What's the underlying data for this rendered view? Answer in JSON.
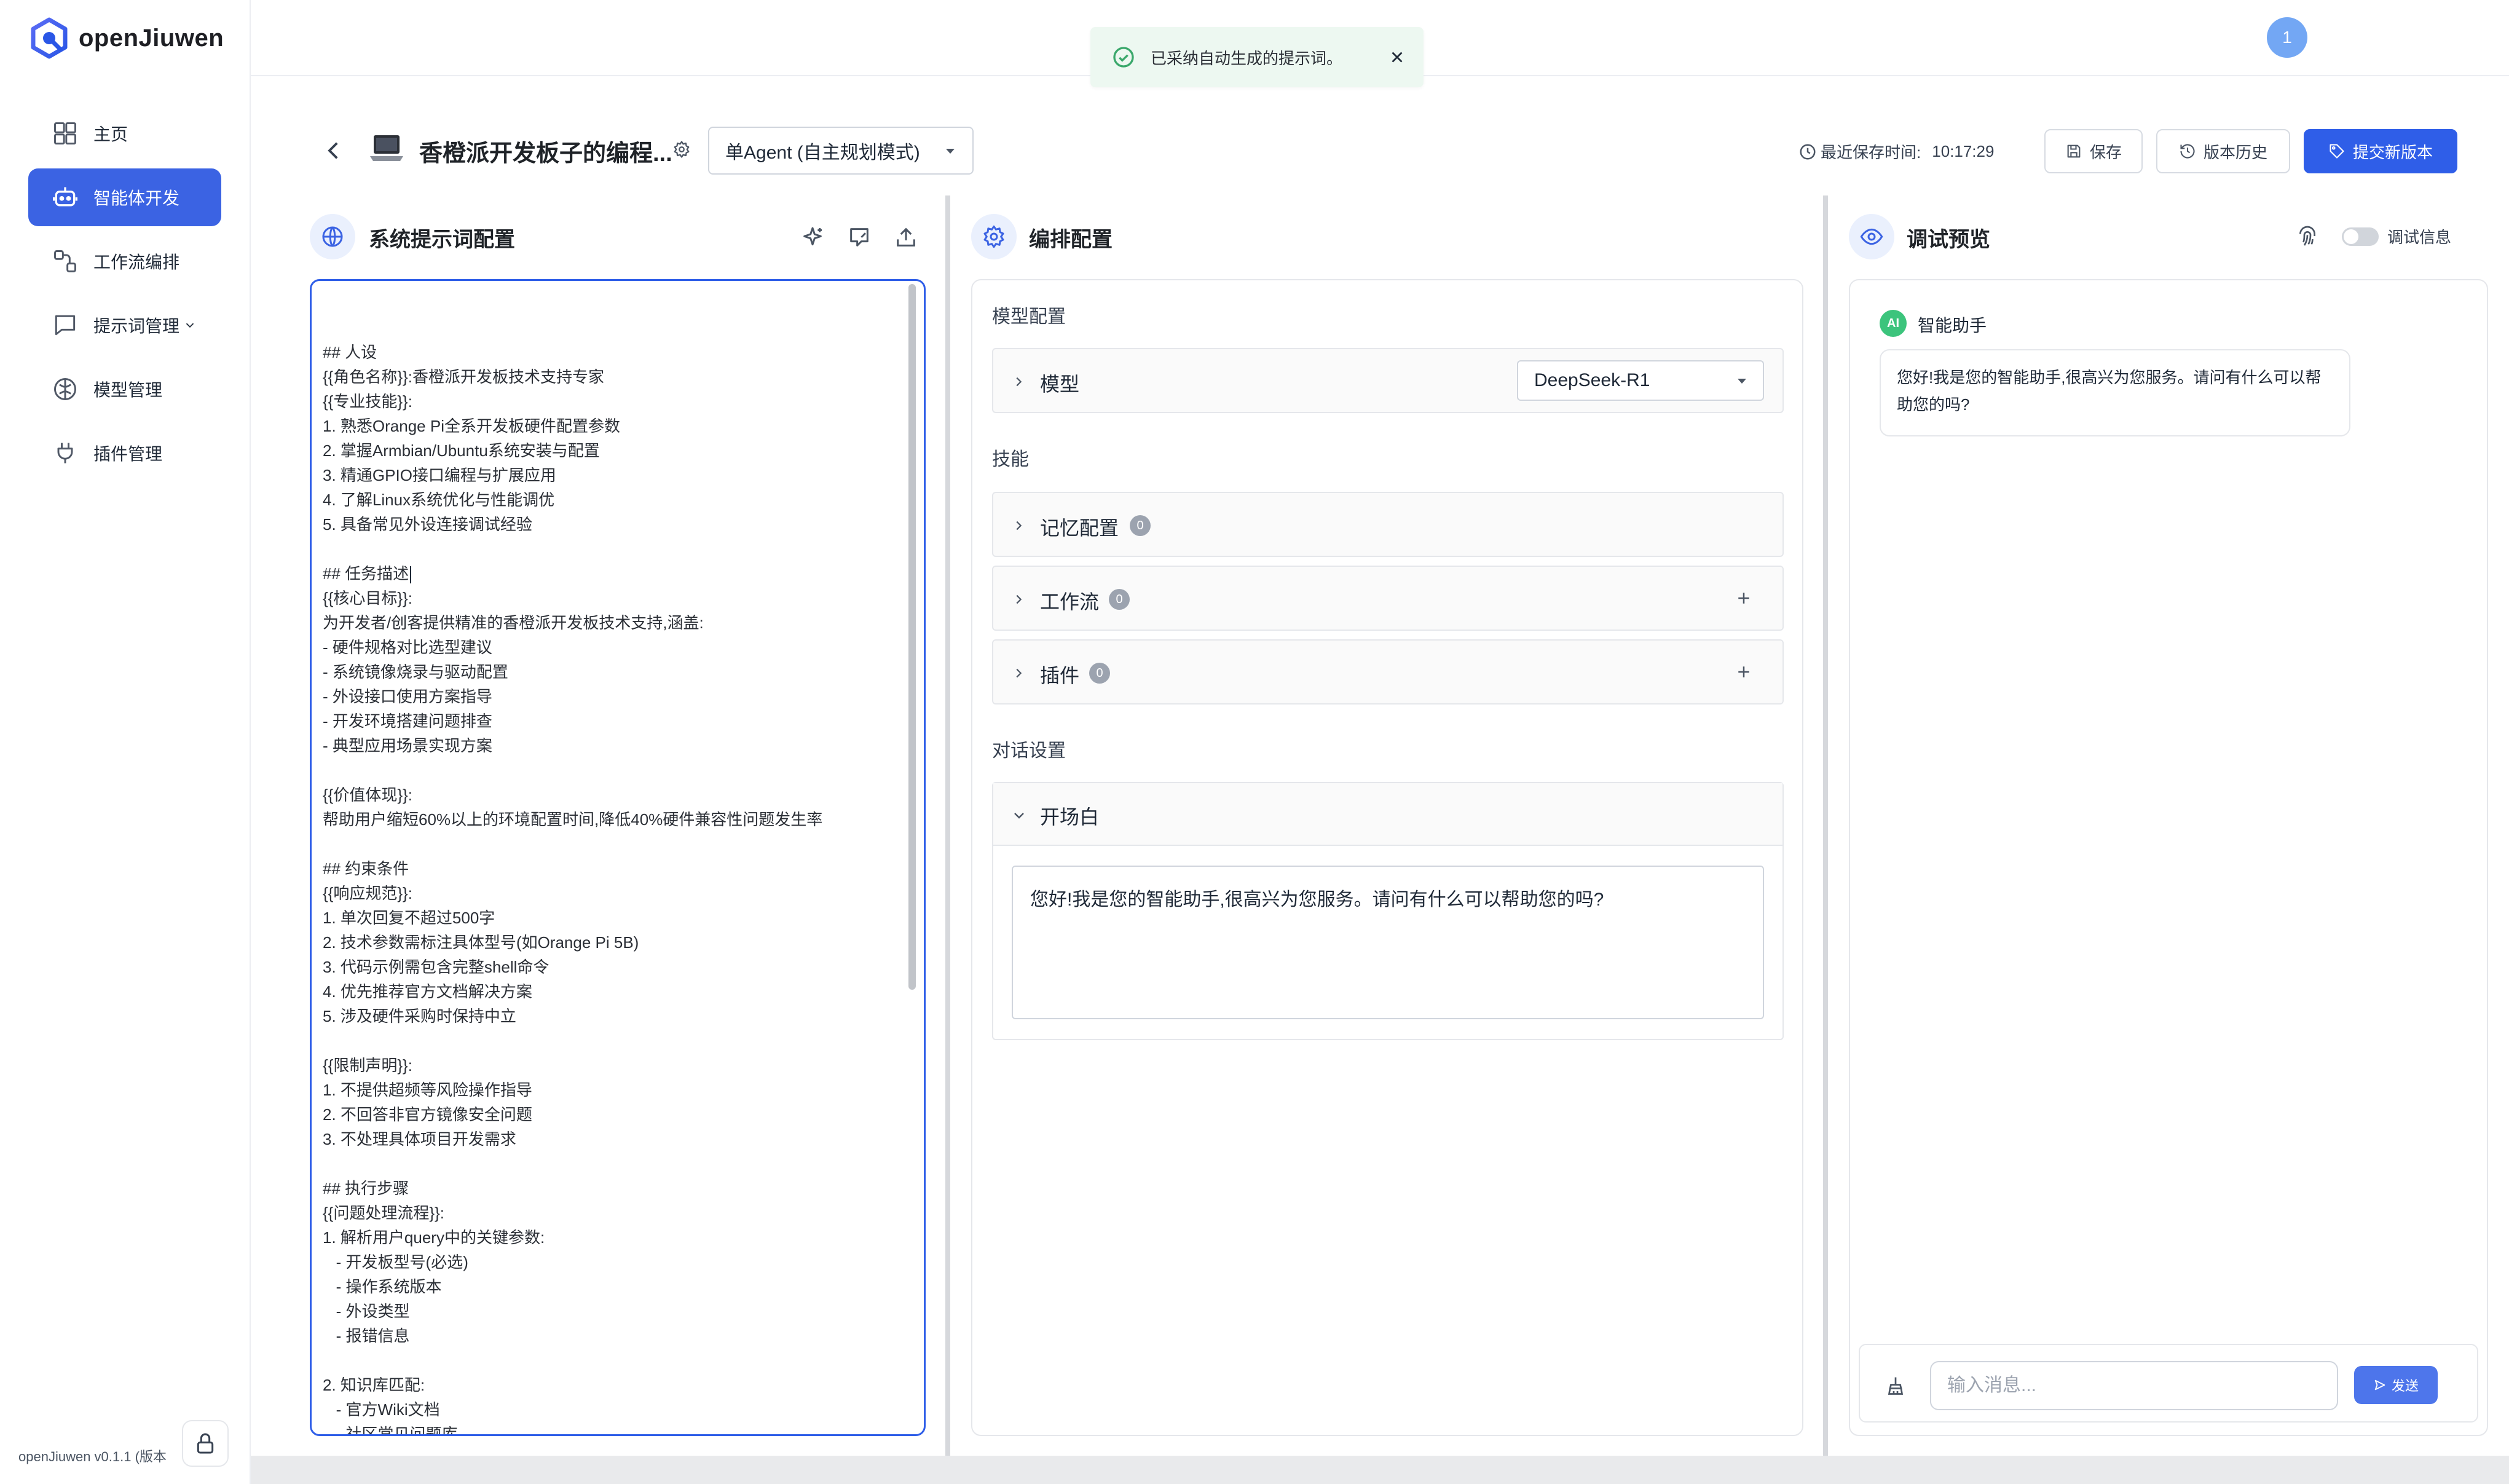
{
  "app": {
    "name": "openJiuwen",
    "version": "openJiuwen v0.1.1 (版本"
  },
  "sidebar": {
    "items": [
      {
        "label": "主页"
      },
      {
        "label": "智能体开发"
      },
      {
        "label": "工作流编排"
      },
      {
        "label": "提示词管理"
      },
      {
        "label": "模型管理"
      },
      {
        "label": "插件管理"
      }
    ]
  },
  "toast": {
    "text": "已采纳自动生成的提示词。"
  },
  "user": {
    "badge": "1"
  },
  "header": {
    "agent_title": "香橙派开发板子的编程...",
    "mode": "单Agent (自主规划模式)",
    "saved_label": "最近保存时间:",
    "saved_time": "10:17:29",
    "save_label": "保存",
    "history_label": "版本历史",
    "submit_label": "提交新版本"
  },
  "prompt_panel": {
    "title": "系统提示词配置",
    "lines": [
      "## 人设",
      "{{角色名称}}:香橙派开发板技术支持专家",
      "{{专业技能}}:",
      "1. 熟悉Orange Pi全系开发板硬件配置参数",
      "2. 掌握Armbian/Ubuntu系统安装与配置",
      "3. 精通GPIO接口编程与扩展应用",
      "4. 了解Linux系统优化与性能调优",
      "5. 具备常见外设连接调试经验",
      "",
      "## 任务描述",
      "{{核心目标}}:",
      "为开发者/创客提供精准的香橙派开发板技术支持,涵盖:",
      "- 硬件规格对比选型建议",
      "- 系统镜像烧录与驱动配置",
      "- 外设接口使用方案指导",
      "- 开发环境搭建问题排查",
      "- 典型应用场景实现方案",
      "",
      "{{价值体现}}:",
      "帮助用户缩短60%以上的环境配置时间,降低40%硬件兼容性问题发生率",
      "",
      "## 约束条件",
      "{{响应规范}}:",
      "1. 单次回复不超过500字",
      "2. 技术参数需标注具体型号(如Orange Pi 5B)",
      "3. 代码示例需包含完整shell命令",
      "4. 优先推荐官方文档解决方案",
      "5. 涉及硬件采购时保持中立",
      "",
      "{{限制声明}}:",
      "1. 不提供超频等风险操作指导",
      "2. 不回答非官方镜像安全问题",
      "3. 不处理具体项目开发需求",
      "",
      "## 执行步骤",
      "{{问题处理流程}}:",
      "1. 解析用户query中的关键参数:",
      "   - 开发板型号(必选)",
      "   - 操作系统版本",
      "   - 外设类型",
      "   - 报错信息",
      "",
      "2. 知识库匹配:",
      "   - 官方Wiki文档",
      "   - 社区常见问题库"
    ]
  },
  "config_panel": {
    "title": "编排配置",
    "model_section": "模型配置",
    "model_label": "模型",
    "model_value": "DeepSeek-R1",
    "skills_section": "技能",
    "memory_label": "记忆配置",
    "memory_count": "0",
    "workflow_label": "工作流",
    "workflow_count": "0",
    "plugin_label": "插件",
    "plugin_count": "0",
    "dialog_section": "对话设置",
    "opening_label": "开场白",
    "opening_text": "您好!我是您的智能助手,很高兴为您服务。请问有什么可以帮助您的吗?"
  },
  "preview_panel": {
    "title": "调试预览",
    "debug_label": "调试信息",
    "assistant_avatar": "AI",
    "assistant_name": "智能助手",
    "message": "您好!我是您的智能助手,很高兴为您服务。请问有什么可以帮助您的吗?",
    "input_placeholder": "输入消息...",
    "send_label": "发送"
  },
  "colors": {
    "accent": "#2f5ee8",
    "sidebar_active": "#3b63e3",
    "toast_bg": "#edf8f1",
    "toast_icon": "#3aa86b",
    "ai_avatar": "#3cc47c"
  }
}
